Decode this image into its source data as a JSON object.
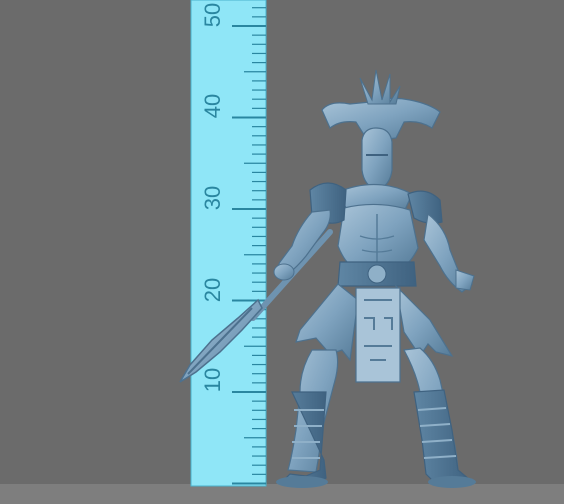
{
  "scene": {
    "background_color": "#6b6b6b",
    "ruler_color": "#8fe6f7",
    "ruler_tick_color": "#2a86a0",
    "model_color": "#7fa3bf",
    "subject": "miniature-warrior-figure-with-spear"
  },
  "ruler": {
    "labels": [
      "10",
      "20",
      "30",
      "40",
      "50"
    ]
  }
}
